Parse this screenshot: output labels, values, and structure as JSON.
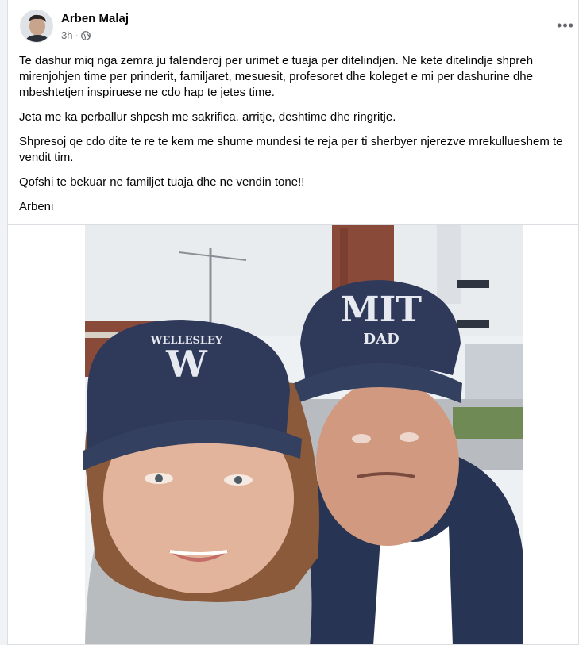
{
  "post": {
    "author": "Arben Malaj",
    "time": "3h",
    "more_label": "•••",
    "icons": {
      "audience": "globe-icon",
      "more": "more-options-icon"
    },
    "paragraphs": [
      "Te dashur miq nga zemra ju falenderoj per urimet e tuaja per ditelindjen. Ne kete ditelindje shpreh mirenjohjen time per prinderit, familjaret, mesuesit, profesoret dhe koleget e mi per dashurine dhe mbeshtetjen inspiruese ne cdo hap te jetes time.",
      "Jeta me ka perballur shpesh me  sakrifica. arritje, deshtime dhe ringritje.",
      "Shpresoj qe cdo dite te re te kem me shume mundesi te reja per ti sherbyer njerezve mrekullueshem te vendit tim.",
      "Qofshi te bekuar ne familjet tuaja dhe ne vendin tone!!",
      "Arbeni"
    ]
  },
  "photo": {
    "cap_left_text": "WELLESLEY",
    "cap_left_letter": "W",
    "cap_right_text": "MIT",
    "cap_right_sub": "DAD",
    "colors": {
      "cap": "#2f3a5a",
      "sky": "#eef1f4",
      "brick": "#8a4a3a"
    }
  }
}
